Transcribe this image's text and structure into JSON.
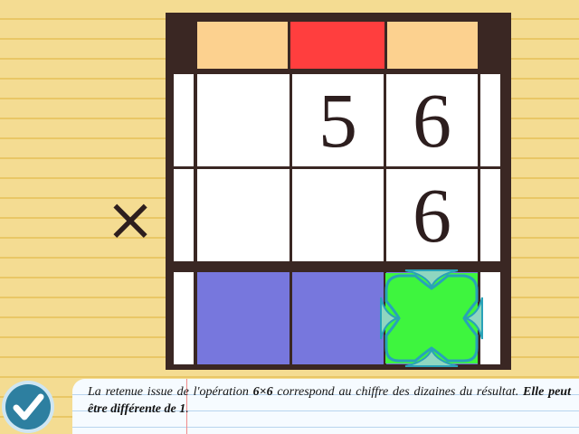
{
  "board": {
    "carry_row": [
      {
        "id": "carry-hundreds",
        "active": false
      },
      {
        "id": "carry-tens",
        "active": true
      },
      {
        "id": "carry-units",
        "active": false
      }
    ],
    "multiplicand": [
      "",
      "5",
      "6"
    ],
    "multiplier": [
      "",
      "",
      "6"
    ],
    "operator": "×",
    "result": [
      "",
      "",
      ""
    ]
  },
  "colors": {
    "background": "#f4dc92",
    "board_frame": "#3a2723",
    "carry_cell": "#fcd18f",
    "carry_cell_active": "#ff3e3e",
    "result_cell": "#7777dd",
    "selector_fill": "#3ef53e",
    "selector_arrows": "#29a2b8",
    "check_button": "#2d7fa0"
  },
  "instruction": {
    "text_part1": "La retenue issue de l'opération ",
    "operation": "6×6",
    "text_part2": " correspond au chiffre des dizaines du résultat.",
    "bold_text": "Elle peut être différente de 1",
    "ending": "."
  },
  "check_button": {
    "icon": "checkmark-icon"
  }
}
